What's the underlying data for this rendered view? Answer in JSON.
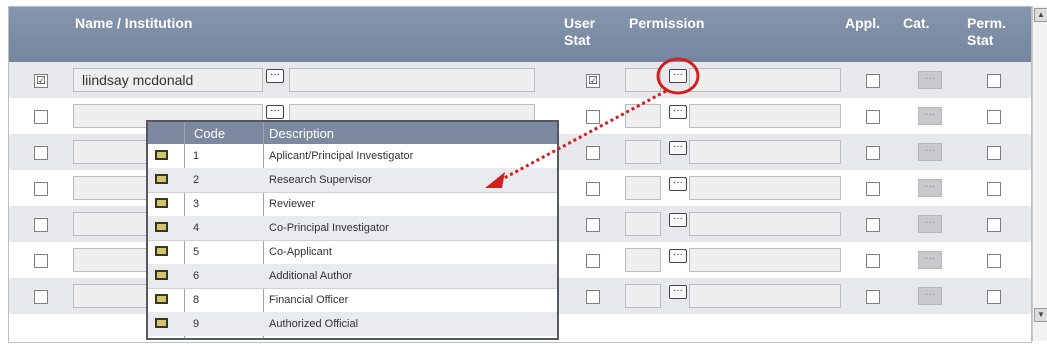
{
  "header": {
    "name_institution": "Name / Institution",
    "user_stat_1": "User",
    "user_stat_2": "Stat",
    "permission": "Permission",
    "appl": "Appl.",
    "cat": "Cat.",
    "perm_stat_1": "Perm.",
    "perm_stat_2": "Stat"
  },
  "rows": [
    {
      "selected": "☑",
      "name": "liindsay mcdonald",
      "user_stat": "☑"
    },
    {
      "selected": "",
      "name": "",
      "user_stat": ""
    },
    {
      "selected": "",
      "name": "",
      "user_stat": ""
    },
    {
      "selected": "",
      "name": "",
      "user_stat": ""
    },
    {
      "selected": "",
      "name": "",
      "user_stat": ""
    },
    {
      "selected": "",
      "name": "",
      "user_stat": ""
    },
    {
      "selected": "",
      "name": "",
      "user_stat": ""
    }
  ],
  "ellipsis": "···",
  "popup": {
    "code_header": "Code",
    "desc_header": "Description",
    "items": [
      {
        "code": "1",
        "description": "Aplicant/Principal Investigator"
      },
      {
        "code": "2",
        "description": "Research Supervisor"
      },
      {
        "code": "3",
        "description": "Reviewer"
      },
      {
        "code": "4",
        "description": "Co-Principal Investigator"
      },
      {
        "code": "5",
        "description": "Co-Applicant"
      },
      {
        "code": "6",
        "description": "Additional Author"
      },
      {
        "code": "8",
        "description": "Financial Officer"
      },
      {
        "code": "9",
        "description": "Authorized Official"
      }
    ]
  },
  "colors": {
    "header_bg": "#7c8ba3",
    "highlight_circle": "#d11f1f",
    "arrow": "#d11f1f",
    "row_alt": "#e7e8ec"
  }
}
